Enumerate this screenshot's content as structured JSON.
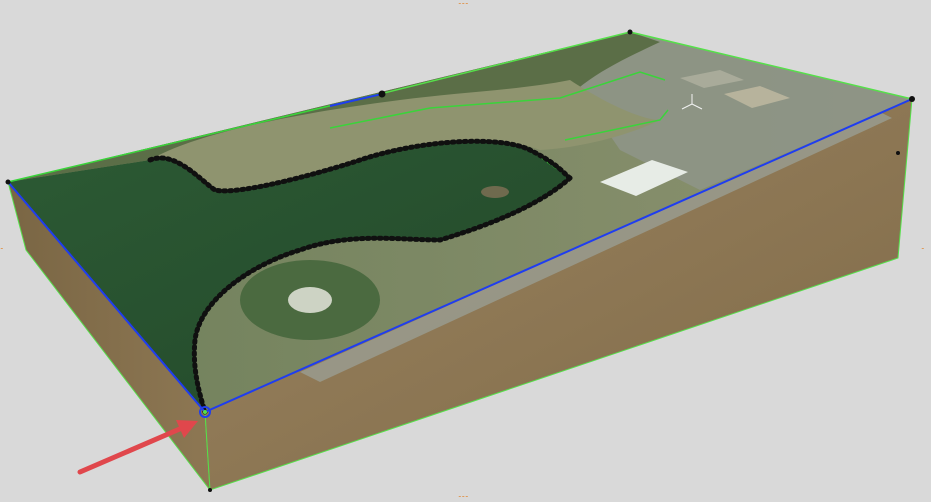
{
  "viewport": {
    "edge_ticks": {
      "top": "⁃⁃⁃",
      "bottom": "⁃⁃⁃",
      "left": "⁃",
      "right": "⁃"
    }
  },
  "scene": {
    "model": "terrain-block",
    "top_surface": "aerial-imagery",
    "side_color": "#8c7653",
    "edge_colors": {
      "selected_edge": "#1f3df0",
      "model_edges": "#56e04a",
      "boundary_line": "#3ad43a"
    },
    "annotation_arrow_color": "#e0474c",
    "vertex_marker_color": "#101010"
  }
}
